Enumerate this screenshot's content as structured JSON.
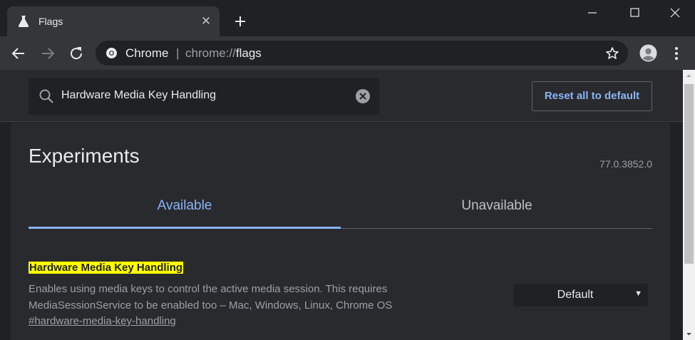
{
  "tab": {
    "title": "Flags",
    "icon": "flask-icon"
  },
  "window": {
    "minimize_icon": "minimize-icon",
    "maximize_icon": "maximize-icon",
    "close_icon": "close-icon"
  },
  "omnibox": {
    "site_label": "Chrome",
    "separator": "|",
    "url_prefix": "chrome://",
    "url_path": "flags"
  },
  "search": {
    "value": "Hardware Media Key Handling"
  },
  "header": {
    "reset_label": "Reset all to default"
  },
  "page": {
    "title": "Experiments",
    "version": "77.0.3852.0"
  },
  "tabs": [
    {
      "label": "Available",
      "active": true
    },
    {
      "label": "Unavailable",
      "active": false
    }
  ],
  "experiment": {
    "name": "Hardware Media Key Handling",
    "description_line1": "Enables using media keys to control the active media session. This requires",
    "description_line2": "MediaSessionService to be enabled too – Mac, Windows, Linux, Chrome OS",
    "link": "#hardware-media-key-handling",
    "selected": "Default"
  },
  "colors": {
    "accent": "#8ab4f8",
    "highlight": "#ffff00",
    "background": "#202124",
    "surface": "#292a2d"
  }
}
